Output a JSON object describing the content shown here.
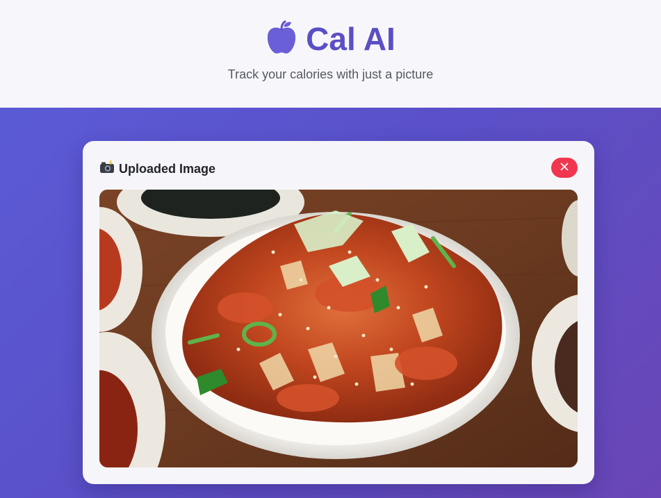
{
  "header": {
    "logo_icon": "apple-icon",
    "title": "Cal AI",
    "tagline": "Track your calories with just a picture"
  },
  "upload_card": {
    "title": "Uploaded Image",
    "title_icon": "camera-flash-icon",
    "close_icon": "close-icon"
  },
  "colors": {
    "brand": "#5b4fc4",
    "gradient_start": "#5b5bd6",
    "gradient_end": "#6a46b6",
    "close_button": "#f1364f"
  }
}
